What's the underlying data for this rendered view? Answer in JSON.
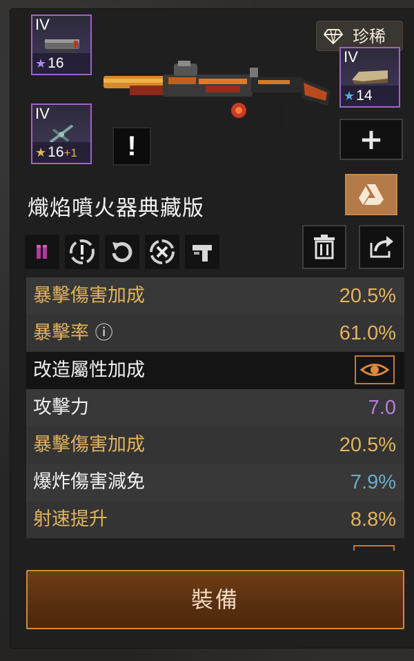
{
  "slots": {
    "top_left": {
      "tier": "IV",
      "star": "★",
      "level": "16",
      "bonus": "",
      "icon": "magazine-icon"
    },
    "mid_left": {
      "tier": "IV",
      "star": "★",
      "level": "16",
      "bonus": "+1",
      "icon": "scope-icon"
    },
    "right": {
      "tier": "IV",
      "star": "★",
      "level": "14",
      "bonus": "",
      "icon": "stock-icon"
    }
  },
  "rarity": {
    "label": "珍稀",
    "icon": "diamond-icon"
  },
  "alert_mark": "!",
  "add_symbol": "+",
  "weapon": {
    "name": "熾焰噴火器典藏版",
    "image": "flamethrower-weapon-image"
  },
  "mod_icons": [
    "ammo-icon",
    "alert-circle-icon",
    "reload-icon",
    "cancel-circle-icon",
    "gun-icon"
  ],
  "stats": [
    {
      "label": "暴擊傷害加成",
      "value": "20.5%",
      "label_color": "gold",
      "value_color": "gold"
    },
    {
      "label": "暴擊率",
      "value": "61.0%",
      "label_color": "gold",
      "value_color": "gold",
      "info_icon": "ⓘ"
    },
    {
      "label": "改造屬性加成",
      "value": "",
      "label_color": "white",
      "header": true
    },
    {
      "label": "攻擊力",
      "value": "7.0",
      "label_color": "white",
      "value_color": "purple"
    },
    {
      "label": "暴擊傷害加成",
      "value": "20.5%",
      "label_color": "gold",
      "value_color": "gold"
    },
    {
      "label": "爆炸傷害減免",
      "value": "7.9%",
      "label_color": "white",
      "value_color": "cyan"
    },
    {
      "label": "射速提升",
      "value": "8.8%",
      "label_color": "gold",
      "value_color": "gold"
    }
  ],
  "equip_button": {
    "label": "裝備"
  },
  "colors": {
    "gold": "#e3b35b",
    "purple": "#b77ce0",
    "cyan": "#6aaec9",
    "slot_border": "#a063c8",
    "accent_orange": "#d08a3a"
  }
}
